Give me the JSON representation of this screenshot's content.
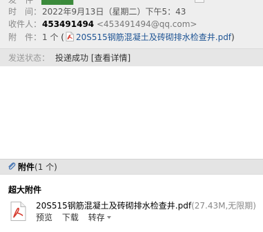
{
  "header": {
    "time_label": "时　间：",
    "time_value": "2022年9月13日（星期二）下午5：43",
    "recipient_label": "收件人：",
    "recipient_name": "453491494",
    "recipient_email": "<453491494@qq.com>",
    "attachment_label": "附　件：",
    "attachment_count": "1 个",
    "attachment_open": "(",
    "attachment_close": ")",
    "attachment_file": "20S515钢筋混凝土及砖砌排水检查井.pdf"
  },
  "status": {
    "label": "发送状态：",
    "value": "投递成功",
    "details_link": "[查看详情]"
  },
  "attachments": {
    "title": "附件",
    "count": "(1 个)",
    "section_title": "超大附件",
    "file": {
      "name": "20S515钢筋混凝土及砖砌排水检查井.pdf",
      "meta": "(27.43M,无限期)",
      "actions": [
        "预览",
        "下载",
        "转存"
      ]
    }
  },
  "colors": {
    "header_bg": "#eeeeee",
    "status_bg": "#e6e6e6",
    "attachment_bar_bg": "#e4e4e4",
    "pdf_red": "#d63b2f",
    "link_blue": "#1e5494"
  },
  "icons": {
    "clip": "paperclip-icon",
    "pdf": "pdf-file-icon",
    "dropdown": "caret-down-icon"
  }
}
